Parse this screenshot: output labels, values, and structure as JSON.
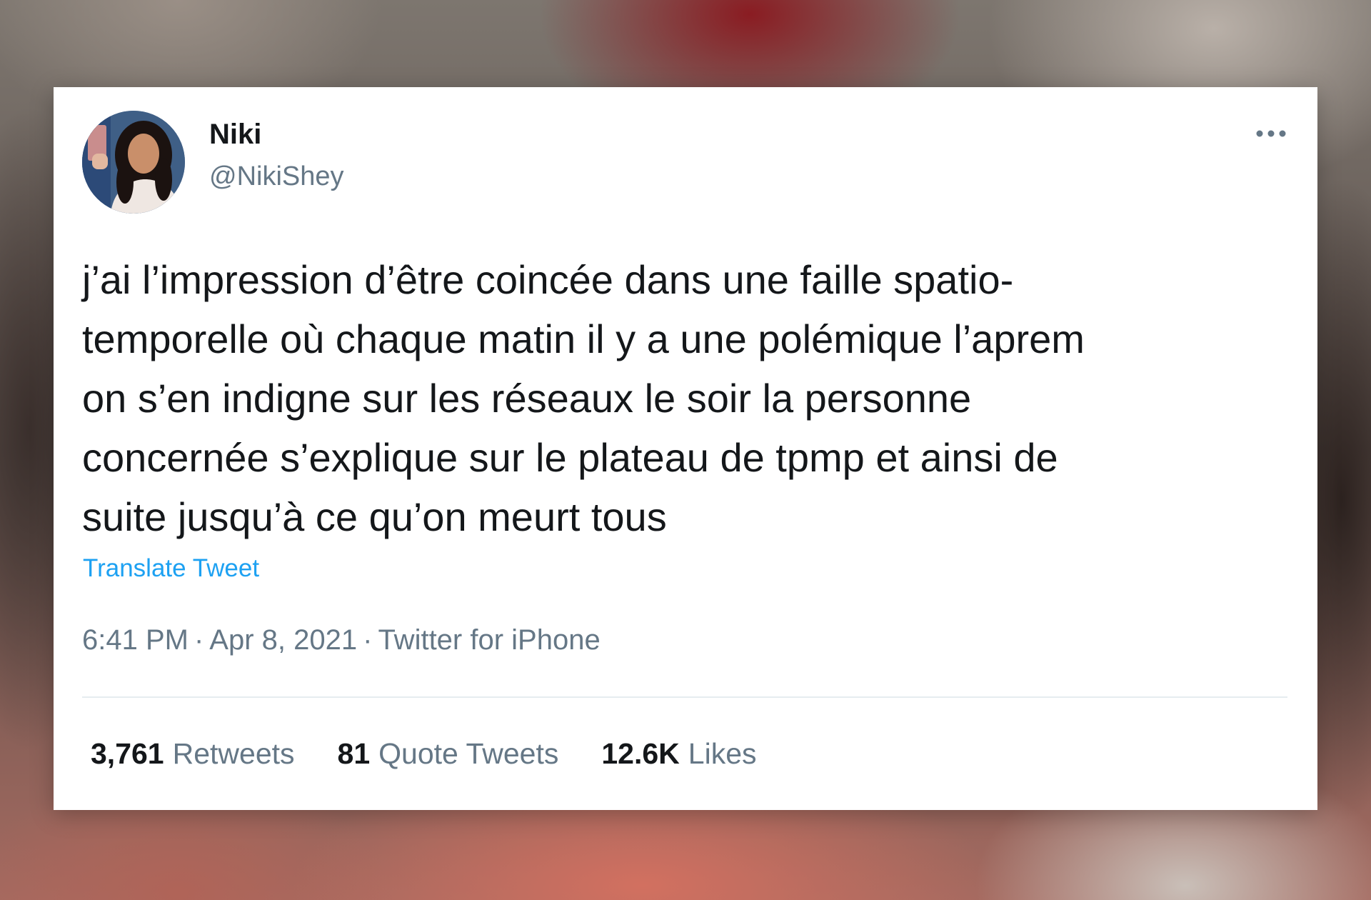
{
  "tweet": {
    "author": {
      "display_name": "Niki",
      "handle": "@NikiShey"
    },
    "more_icon": "more-horizontal-icon",
    "text": "j’ai l’impression d’être coincée dans une faille spatio-\ntemporelle où chaque matin il y a une polémique l’aprem\non s’en indigne sur les réseaux le soir la personne\nconcernée s’explique sur le plateau de tpmp et ainsi de\nsuite jusqu’à ce qu’on meurt tous",
    "translate_label": "Translate Tweet",
    "time": "6:41 PM",
    "separator": "·",
    "date": "Apr 8, 2021",
    "source": "Twitter for iPhone",
    "stats": {
      "retweets_count": "3,761",
      "retweets_label": "Retweets",
      "quotes_count": "81",
      "quotes_label": "Quote Tweets",
      "likes_count": "12.6K",
      "likes_label": "Likes"
    }
  },
  "colors": {
    "link": "#1da1f2",
    "secondary_text": "#657786",
    "primary_text": "#14171a"
  }
}
